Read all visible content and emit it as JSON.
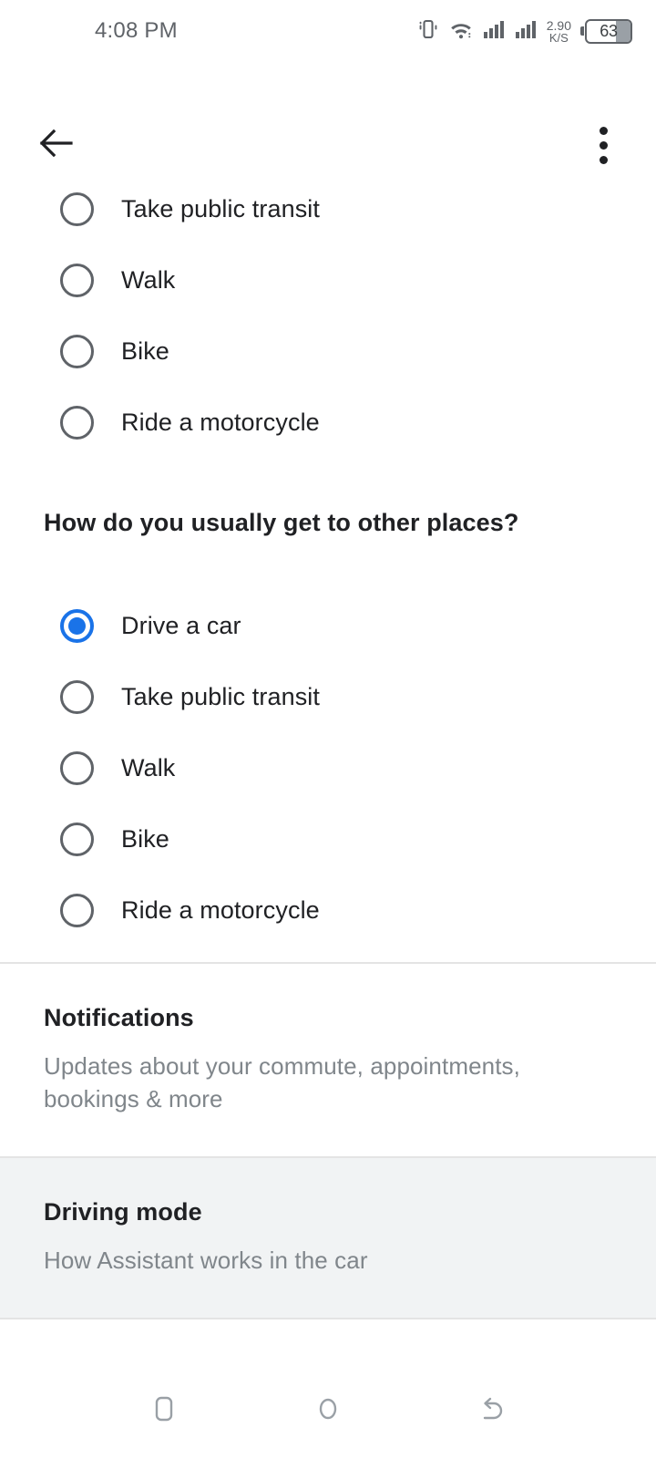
{
  "status_bar": {
    "time": "4:08 PM",
    "icons": [
      "vibrate-icon",
      "wifi-icon",
      "signal-icon-1",
      "signal-icon-2"
    ],
    "net_speed_value": "2.90",
    "net_speed_unit": "K/S",
    "battery_level": "63"
  },
  "app_bar": {
    "back_icon": "back-arrow-icon",
    "overflow_icon": "more-vertical-icon"
  },
  "colors": {
    "accent": "#1a73e8",
    "text_primary": "#202124",
    "text_secondary": "#80868b",
    "radio_outline": "#5f6368",
    "divider": "#e4e4e4",
    "pressed_row": "#f1f3f4"
  },
  "groups": [
    {
      "question": "",
      "options": [
        {
          "label": "Take public transit",
          "selected": false
        },
        {
          "label": "Walk",
          "selected": false
        },
        {
          "label": "Bike",
          "selected": false
        },
        {
          "label": "Ride a motorcycle",
          "selected": false
        }
      ]
    },
    {
      "question": "How do you usually get to other places?",
      "options": [
        {
          "label": "Drive a car",
          "selected": true
        },
        {
          "label": "Take public transit",
          "selected": false
        },
        {
          "label": "Walk",
          "selected": false
        },
        {
          "label": "Bike",
          "selected": false
        },
        {
          "label": "Ride a motorcycle",
          "selected": false
        }
      ]
    }
  ],
  "preferences": [
    {
      "title": "Notifications",
      "subtitle": "Updates about your commute, appointments, bookings & more",
      "pressed": false
    },
    {
      "title": "Driving mode",
      "subtitle": "How Assistant works in the car",
      "pressed": true
    }
  ],
  "nav_bar": {
    "recents_label": "recents-icon",
    "home_label": "home-icon",
    "back_label": "back-icon"
  }
}
